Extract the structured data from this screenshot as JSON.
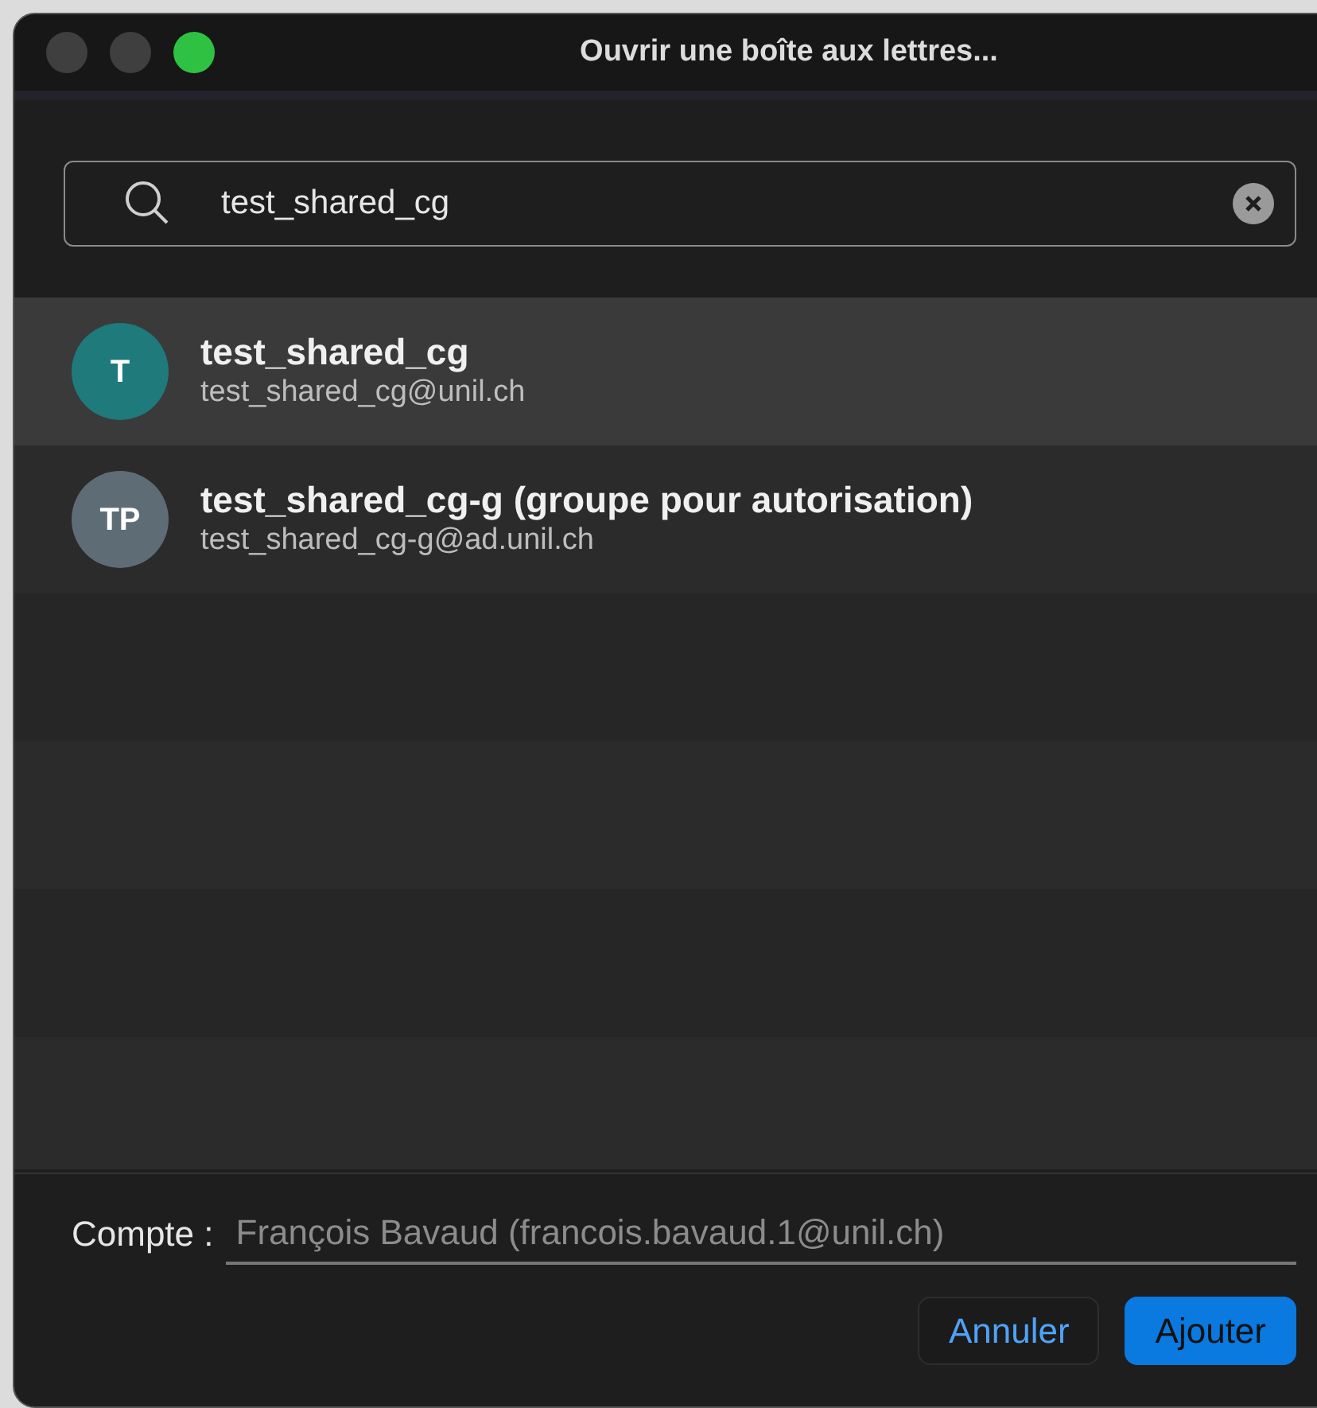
{
  "window": {
    "title": "Ouvrir une boîte aux lettres..."
  },
  "search": {
    "value": "test_shared_cg"
  },
  "results": [
    {
      "initials": "T",
      "name": "test_shared_cg",
      "email": "test_shared_cg@unil.ch",
      "color": "#1f7a7c",
      "selected": true
    },
    {
      "initials": "TP",
      "name": "test_shared_cg-g (groupe pour autorisation)",
      "email": "test_shared_cg-g@ad.unil.ch",
      "color": "#5e6d75",
      "selected": false
    }
  ],
  "account": {
    "label": "Compte :",
    "value": "François Bavaud (francois.bavaud.1@unil.ch)",
    "disabled": true
  },
  "buttons": [
    {
      "label": "Annuler",
      "kind": "secondary"
    },
    {
      "label": "Ajouter",
      "kind": "primary"
    }
  ]
}
